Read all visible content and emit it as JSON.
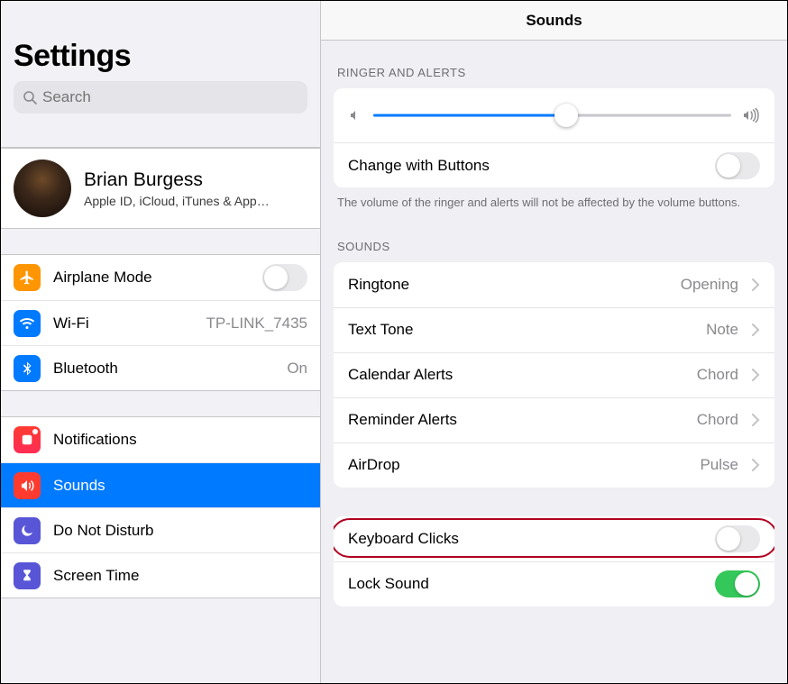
{
  "sidebar": {
    "title": "Settings",
    "search_placeholder": "Search",
    "profile": {
      "name": "Brian Burgess",
      "sub": "Apple ID, iCloud, iTunes & App…"
    },
    "group1": [
      {
        "id": "airplane",
        "label": "Airplane Mode",
        "icon": "airplane",
        "color": "orange",
        "type": "switch",
        "on": false
      },
      {
        "id": "wifi",
        "label": "Wi-Fi",
        "icon": "wifi",
        "color": "blue",
        "type": "nav",
        "value": "TP-LINK_7435"
      },
      {
        "id": "bluetooth",
        "label": "Bluetooth",
        "icon": "bluetooth",
        "color": "blue",
        "type": "nav",
        "value": "On"
      }
    ],
    "group2": [
      {
        "id": "notifications",
        "label": "Notifications",
        "icon": "notifications",
        "color": "red-grad"
      },
      {
        "id": "sounds",
        "label": "Sounds",
        "icon": "speaker",
        "color": "red",
        "selected": true
      },
      {
        "id": "dnd",
        "label": "Do Not Disturb",
        "icon": "moon",
        "color": "purple"
      },
      {
        "id": "screentime",
        "label": "Screen Time",
        "icon": "hourglass",
        "color": "indigo"
      }
    ]
  },
  "detail": {
    "title": "Sounds",
    "section_ringer": "RINGER AND ALERTS",
    "slider_percent": 54,
    "change_with_buttons": {
      "label": "Change with Buttons",
      "on": false
    },
    "ringer_note": "The volume of the ringer and alerts will not be affected by the volume buttons.",
    "section_sounds": "SOUNDS",
    "sound_rows": [
      {
        "id": "ringtone",
        "label": "Ringtone",
        "value": "Opening"
      },
      {
        "id": "texttone",
        "label": "Text Tone",
        "value": "Note"
      },
      {
        "id": "calendar",
        "label": "Calendar Alerts",
        "value": "Chord"
      },
      {
        "id": "reminder",
        "label": "Reminder Alerts",
        "value": "Chord"
      },
      {
        "id": "airdrop",
        "label": "AirDrop",
        "value": "Pulse"
      }
    ],
    "toggles": [
      {
        "id": "keyboard",
        "label": "Keyboard Clicks",
        "on": false,
        "highlight": true
      },
      {
        "id": "lock",
        "label": "Lock Sound",
        "on": true
      }
    ]
  }
}
